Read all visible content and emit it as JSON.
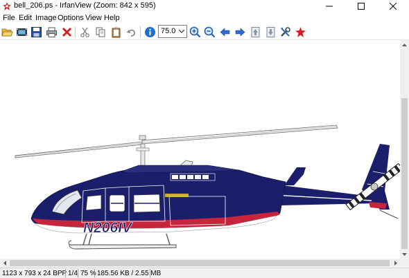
{
  "window": {
    "title": "bell_206.ps - IrfanView (Zoom: 842 x 595)"
  },
  "menu": [
    "File",
    "Edit",
    "Image",
    "Options",
    "View",
    "Help"
  ],
  "toolbar": {
    "zoom_value": "75.0"
  },
  "image": {
    "tail_number": "N206IV",
    "fuselage_color": "#1b1f6b",
    "stripe_color": "#c8243c"
  },
  "status": {
    "dimensions": "1123 x 793 x 24 BPP",
    "page": "1/4",
    "zoom": "75 %",
    "size": "185.56 KB / 2.55 MB"
  }
}
